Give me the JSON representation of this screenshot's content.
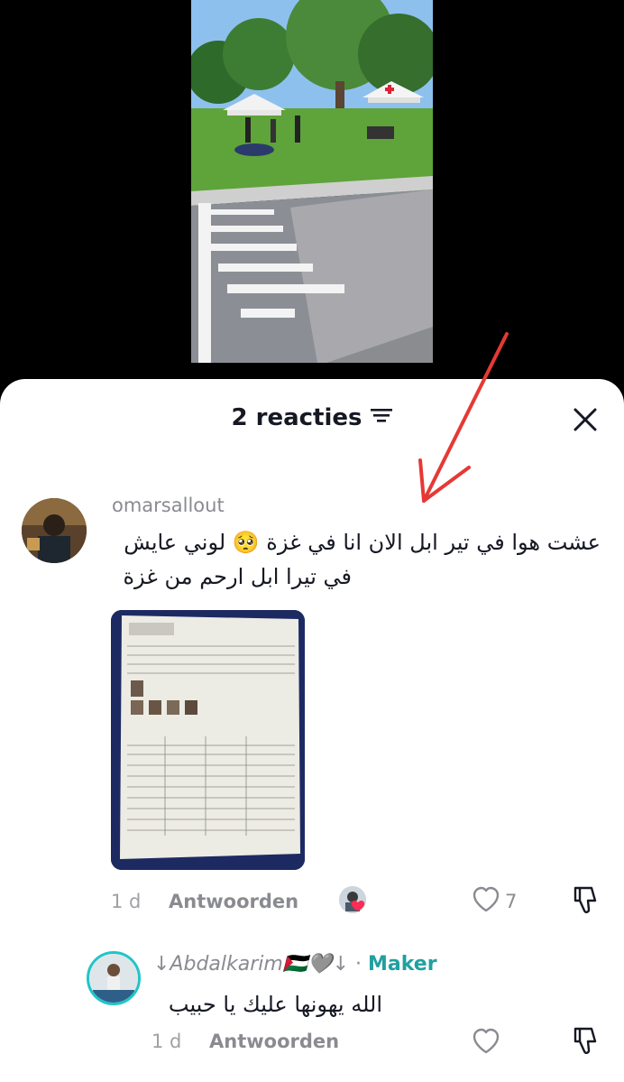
{
  "sheet": {
    "reactions_label": "2 reacties"
  },
  "comment": {
    "username": "omarsallout",
    "text_line1": "عشت هوا في تير ابل الان انا في غزة 🥺 لوني عايش",
    "text_line2": "في تيرا ابل ارحم من غزة",
    "time": "1 d",
    "reply_label": "Antwoorden",
    "like_count": "7"
  },
  "reply": {
    "username": "↓Abdalkarim🇵🇸🩶↓",
    "separator": " · ",
    "badge": "Maker",
    "text": "الله يهونها عليك يا حبيب",
    "time": "1 d",
    "reply_label": "Antwoorden"
  },
  "colors": {
    "accent_teal": "#20a0a0",
    "arrow_red": "#e53935",
    "heart_pink": "#fe2c55"
  },
  "icons": [
    "filter-icon",
    "close-icon",
    "heart-icon",
    "dislike-icon"
  ]
}
